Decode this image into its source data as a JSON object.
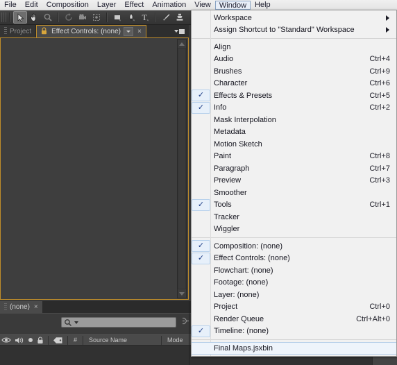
{
  "menubar": {
    "items": [
      {
        "label": "File",
        "active": false
      },
      {
        "label": "Edit",
        "active": false
      },
      {
        "label": "Composition",
        "active": false
      },
      {
        "label": "Layer",
        "active": false
      },
      {
        "label": "Effect",
        "active": false
      },
      {
        "label": "Animation",
        "active": false
      },
      {
        "label": "View",
        "active": false
      },
      {
        "label": "Window",
        "active": true
      },
      {
        "label": "Help",
        "active": false
      }
    ]
  },
  "toolbar": {
    "tools": [
      {
        "name": "selection-tool",
        "selected": true
      },
      {
        "name": "hand-tool",
        "selected": false
      },
      {
        "name": "zoom-tool",
        "selected": false
      },
      {
        "name": "rotation-tool",
        "selected": false
      },
      {
        "name": "camera-tool",
        "selected": false
      },
      {
        "name": "pan-behind-tool",
        "selected": false
      },
      {
        "name": "shape-tool",
        "selected": false
      },
      {
        "name": "pen-tool",
        "selected": false
      },
      {
        "name": "type-tool",
        "selected": false
      },
      {
        "name": "brush-tool",
        "selected": false
      },
      {
        "name": "clone-stamp-tool",
        "selected": false
      },
      {
        "name": "eraser-tool",
        "selected": false
      }
    ]
  },
  "effect_controls_panel": {
    "tabs": [
      {
        "label": "Project",
        "active": false
      },
      {
        "label": "Effect Controls: (none)",
        "active": true
      }
    ],
    "close_label": "×"
  },
  "timeline_panel": {
    "tab_label": "(none)",
    "close_label": "×",
    "search": {
      "value": "",
      "placeholder": ""
    },
    "columns": [
      {
        "label": "#"
      },
      {
        "label": "Source Name"
      },
      {
        "label": "Mode"
      }
    ]
  },
  "window_menu": {
    "groups": [
      {
        "items": [
          {
            "label": "Workspace",
            "accel": "",
            "checked": false,
            "submenu": true,
            "highlighted": false
          },
          {
            "label": "Assign Shortcut to \"Standard\" Workspace",
            "accel": "",
            "checked": false,
            "submenu": true,
            "highlighted": false
          }
        ]
      },
      {
        "items": [
          {
            "label": "Align",
            "accel": "",
            "checked": false,
            "submenu": false,
            "highlighted": false
          },
          {
            "label": "Audio",
            "accel": "Ctrl+4",
            "checked": false,
            "submenu": false,
            "highlighted": false
          },
          {
            "label": "Brushes",
            "accel": "Ctrl+9",
            "checked": false,
            "submenu": false,
            "highlighted": false
          },
          {
            "label": "Character",
            "accel": "Ctrl+6",
            "checked": false,
            "submenu": false,
            "highlighted": false
          },
          {
            "label": "Effects & Presets",
            "accel": "Ctrl+5",
            "checked": true,
            "submenu": false,
            "highlighted": false
          },
          {
            "label": "Info",
            "accel": "Ctrl+2",
            "checked": true,
            "submenu": false,
            "highlighted": false
          },
          {
            "label": "Mask Interpolation",
            "accel": "",
            "checked": false,
            "submenu": false,
            "highlighted": false
          },
          {
            "label": "Metadata",
            "accel": "",
            "checked": false,
            "submenu": false,
            "highlighted": false
          },
          {
            "label": "Motion Sketch",
            "accel": "",
            "checked": false,
            "submenu": false,
            "highlighted": false
          },
          {
            "label": "Paint",
            "accel": "Ctrl+8",
            "checked": false,
            "submenu": false,
            "highlighted": false
          },
          {
            "label": "Paragraph",
            "accel": "Ctrl+7",
            "checked": false,
            "submenu": false,
            "highlighted": false
          },
          {
            "label": "Preview",
            "accel": "Ctrl+3",
            "checked": false,
            "submenu": false,
            "highlighted": false
          },
          {
            "label": "Smoother",
            "accel": "",
            "checked": false,
            "submenu": false,
            "highlighted": false
          },
          {
            "label": "Tools",
            "accel": "Ctrl+1",
            "checked": true,
            "submenu": false,
            "highlighted": false
          },
          {
            "label": "Tracker",
            "accel": "",
            "checked": false,
            "submenu": false,
            "highlighted": false
          },
          {
            "label": "Wiggler",
            "accel": "",
            "checked": false,
            "submenu": false,
            "highlighted": false
          }
        ]
      },
      {
        "items": [
          {
            "label": "Composition: (none)",
            "accel": "",
            "checked": true,
            "submenu": false,
            "highlighted": false
          },
          {
            "label": "Effect Controls: (none)",
            "accel": "",
            "checked": true,
            "submenu": false,
            "highlighted": false
          },
          {
            "label": "Flowchart: (none)",
            "accel": "",
            "checked": false,
            "submenu": false,
            "highlighted": false
          },
          {
            "label": "Footage: (none)",
            "accel": "",
            "checked": false,
            "submenu": false,
            "highlighted": false
          },
          {
            "label": "Layer: (none)",
            "accel": "",
            "checked": false,
            "submenu": false,
            "highlighted": false
          },
          {
            "label": "Project",
            "accel": "Ctrl+0",
            "checked": false,
            "submenu": false,
            "highlighted": false
          },
          {
            "label": "Render Queue",
            "accel": "Ctrl+Alt+0",
            "checked": false,
            "submenu": false,
            "highlighted": false
          },
          {
            "label": "Timeline: (none)",
            "accel": "",
            "checked": true,
            "submenu": false,
            "highlighted": false
          }
        ]
      },
      {
        "items": [
          {
            "label": "Final Maps.jsxbin",
            "accel": "",
            "checked": false,
            "submenu": false,
            "highlighted": true
          }
        ]
      }
    ],
    "check_glyph": "✓"
  },
  "colors": {
    "menu_bg": "#f1f1f1",
    "menu_text": "#15151f",
    "check_blue": "#1b3c85",
    "highlight_bg": "#eef4fb",
    "panel_accent": "#c18e2a",
    "app_bg": "#393939"
  }
}
